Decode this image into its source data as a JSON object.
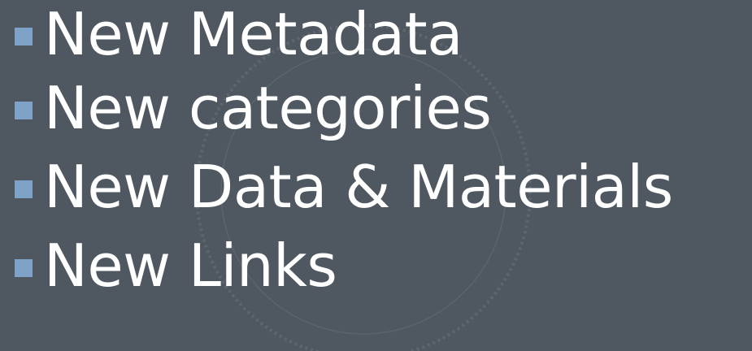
{
  "theme": {
    "background": "#4f5860",
    "text_color": "#ffffff",
    "bullet_color": "#7fa3c8",
    "decor_color": "#6a737b"
  },
  "bullets": [
    {
      "label": "New Metadata",
      "icon": "square-bullet-icon"
    },
    {
      "label": "New categories",
      "icon": "square-bullet-icon"
    },
    {
      "label": "New Data & Materials",
      "icon": "square-bullet-icon"
    },
    {
      "label": "New Links",
      "icon": "square-bullet-icon"
    }
  ]
}
